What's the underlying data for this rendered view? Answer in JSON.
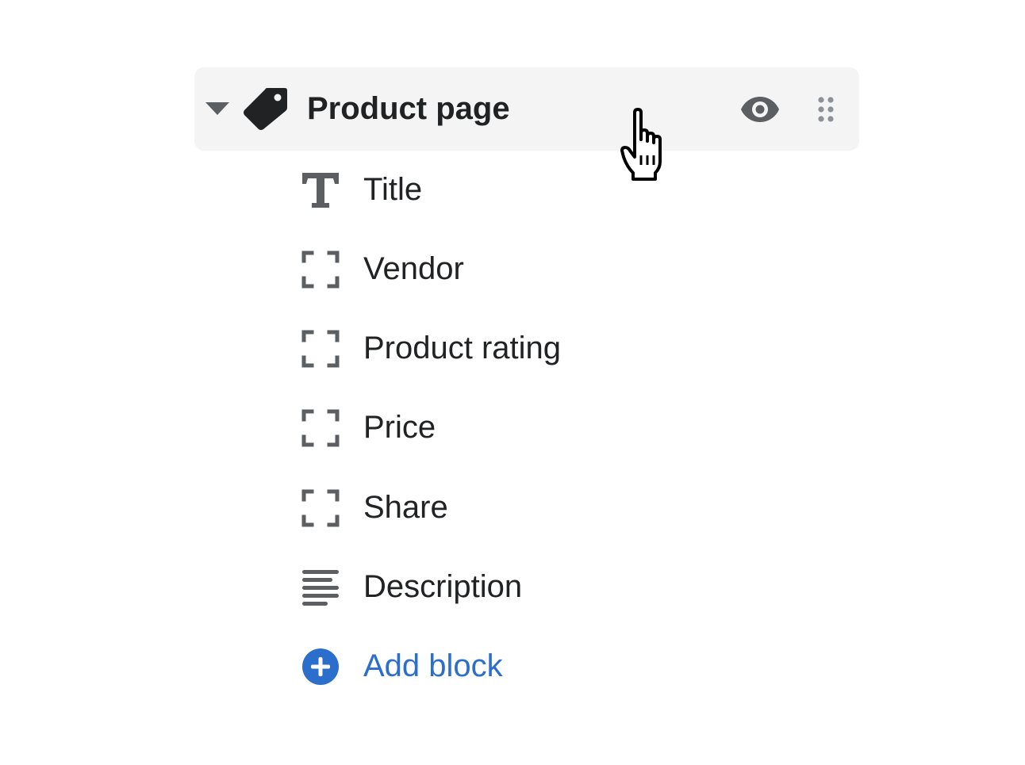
{
  "section": {
    "title": "Product page",
    "collapse_icon": "caret-down-icon",
    "section_icon": "tag-icon",
    "visibility_icon": "eye-icon",
    "drag_icon": "drag-handle-icon"
  },
  "blocks": [
    {
      "label": "Title",
      "icon": "text-title-icon"
    },
    {
      "label": "Vendor",
      "icon": "dashed-frame-icon"
    },
    {
      "label": "Product rating",
      "icon": "dashed-frame-icon"
    },
    {
      "label": "Price",
      "icon": "dashed-frame-icon"
    },
    {
      "label": "Share",
      "icon": "dashed-frame-icon"
    },
    {
      "label": "Description",
      "icon": "text-align-left-icon"
    }
  ],
  "add_block": {
    "label": "Add block",
    "icon": "circle-plus-icon",
    "color": "#2c6ecb"
  },
  "colors": {
    "header_bg": "#f4f4f4",
    "text": "#202223",
    "icon": "#5c5f62"
  }
}
